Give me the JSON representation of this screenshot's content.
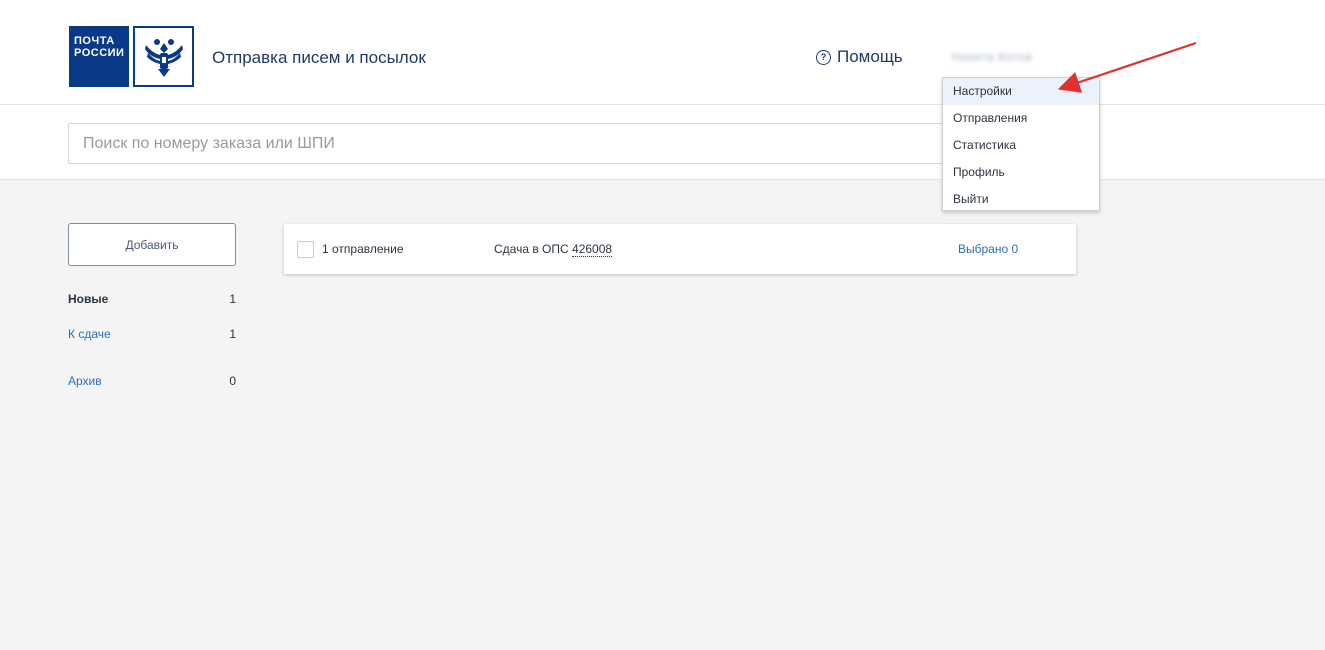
{
  "header": {
    "logo_line1": "ПОЧТА",
    "logo_line2": "РОССИИ",
    "app_title": "Отправка писем и посылок",
    "help_label": "Помощь",
    "user_name": "Никита Котов"
  },
  "user_menu": {
    "items": [
      "Настройки",
      "Отправления",
      "Статистика",
      "Профиль",
      "Выйти"
    ],
    "highlighted": "Настройки"
  },
  "search": {
    "placeholder": "Поиск по номеру заказа или ШПИ",
    "value": ""
  },
  "sidebar": {
    "add_label": "Добавить",
    "items": [
      {
        "label": "Новые",
        "count": "1",
        "active": true
      },
      {
        "label": "К сдаче",
        "count": "1",
        "active": false
      },
      {
        "label": "Архив",
        "count": "0",
        "active": false
      }
    ]
  },
  "batch_card": {
    "shipments": "1 отправление",
    "handover_prefix": "Сдача в ОПС",
    "ops_code": "426008",
    "selected": "Выбрано 0"
  },
  "colors": {
    "brand_blue": "#0a3a87",
    "link_blue": "#2b6fb6",
    "annotation_red": "#e53030",
    "background": "#f4f4f4"
  },
  "icons": [
    "help-circle-icon",
    "double-headed-eagle-emblem-icon",
    "checkbox-icon",
    "red-arrow-annotation"
  ]
}
